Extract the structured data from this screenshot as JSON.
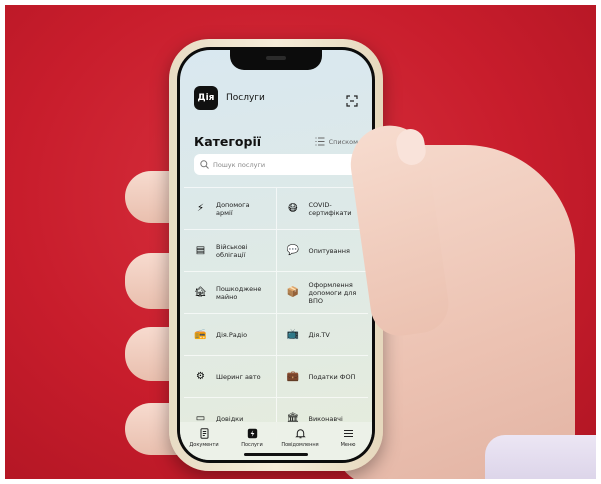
{
  "header": {
    "logo_text": "Дія",
    "title": "Послуги",
    "scan_icon": "scan-icon"
  },
  "categories": {
    "title": "Категорії",
    "view_toggle_label": "Списком",
    "search_placeholder": "Пошук послуги"
  },
  "grid": [
    [
      {
        "icon": "lightning-icon",
        "glyph": "⚡",
        "label_lines": [
          "Допомога",
          "армії"
        ]
      },
      {
        "icon": "mask-face-icon",
        "glyph": "😷",
        "label_lines": [
          "COVID-",
          "сертифікати"
        ]
      }
    ],
    [
      {
        "icon": "bond-icon",
        "glyph": "▤",
        "label_lines": [
          "Військові",
          "облігації"
        ]
      },
      {
        "icon": "chat-bubble-icon",
        "glyph": "💬",
        "label_lines": [
          "Опитування"
        ]
      }
    ],
    [
      {
        "icon": "damaged-house-icon",
        "glyph": "🏚",
        "label_lines": [
          "Пошкоджене",
          "майно"
        ]
      },
      {
        "icon": "box-icon",
        "glyph": "📦",
        "label_lines": [
          "Оформлення",
          "допомоги для",
          "ВПО"
        ]
      }
    ],
    [
      {
        "icon": "radio-icon",
        "glyph": "📻",
        "label_lines": [
          "Дія.Радіо"
        ]
      },
      {
        "icon": "tv-icon",
        "glyph": "📺",
        "label_lines": [
          "Дія.TV"
        ]
      }
    ],
    [
      {
        "icon": "car-sharing-icon",
        "glyph": "⚙",
        "label_lines": [
          "Шеринг авто"
        ]
      },
      {
        "icon": "briefcase-icon",
        "glyph": "💼",
        "label_lines": [
          "Податки ФОП"
        ]
      }
    ],
    [
      {
        "icon": "certificate-icon",
        "glyph": "▭",
        "label_lines": [
          "Довідки"
        ]
      },
      {
        "icon": "court-icon",
        "glyph": "🏛",
        "label_lines": [
          "Виконавчі"
        ]
      }
    ]
  ],
  "bottom_nav": [
    {
      "icon": "document-icon",
      "label": "Документи",
      "active": false
    },
    {
      "icon": "services-icon",
      "label": "Послуги",
      "active": true
    },
    {
      "icon": "bell-icon",
      "label": "Повідомлення",
      "active": false
    },
    {
      "icon": "menu-icon",
      "label": "Меню",
      "active": false
    }
  ],
  "colors": {
    "background_red": "#c81d2c",
    "app_bg": "#dde9e8",
    "logo_bg": "#111111"
  }
}
